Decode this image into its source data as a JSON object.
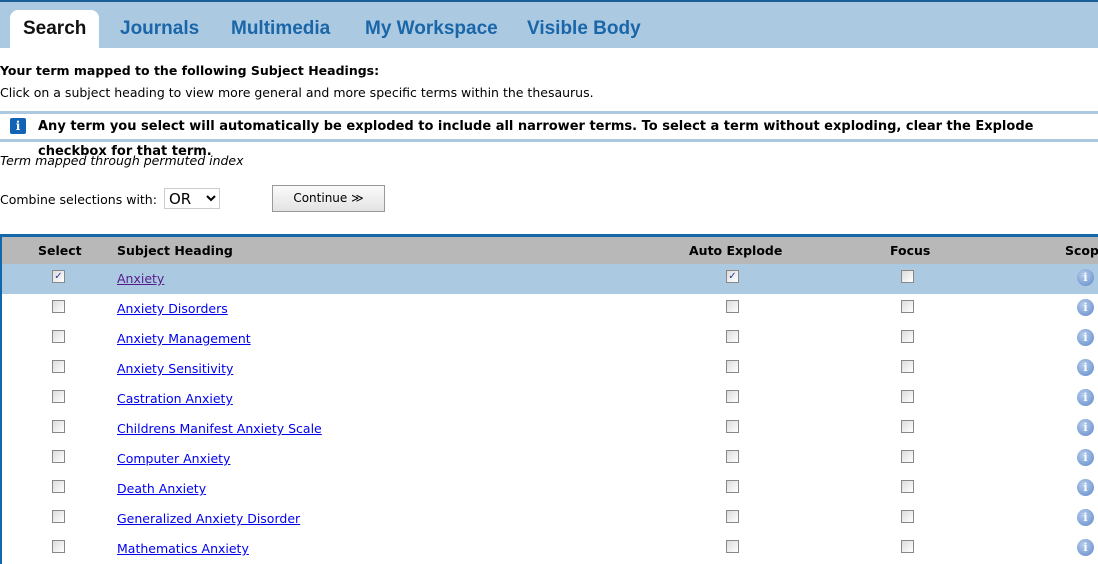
{
  "tabs": [
    {
      "label": "Search",
      "active": true
    },
    {
      "label": "Journals"
    },
    {
      "label": "Multimedia"
    },
    {
      "label": "My Workspace"
    },
    {
      "label": "Visible Body"
    }
  ],
  "intro": {
    "title": "Your term mapped to the following Subject Headings:",
    "subtitle": "Click on a subject heading to view more general and more specific terms within the thesaurus."
  },
  "notice": "Any term you select will automatically be exploded to include all narrower terms. To select a term without exploding, clear the Explode checkbox for that term.",
  "mapped_note": "Term mapped through permuted index",
  "combine": {
    "label": "Combine selections with:",
    "value": "OR"
  },
  "continue_label": "Continue ≫",
  "table": {
    "headers": {
      "select": "Select",
      "heading": "Subject Heading",
      "explode": "Auto Explode",
      "focus": "Focus",
      "scope": "Scope"
    },
    "rows": [
      {
        "heading": "Anxiety",
        "selected": true,
        "explode": true,
        "focus": false
      },
      {
        "heading": "Anxiety Disorders",
        "selected": false,
        "explode": false,
        "focus": false
      },
      {
        "heading": "Anxiety Management",
        "selected": false,
        "explode": false,
        "focus": false
      },
      {
        "heading": "Anxiety Sensitivity",
        "selected": false,
        "explode": false,
        "focus": false
      },
      {
        "heading": "Castration Anxiety",
        "selected": false,
        "explode": false,
        "focus": false
      },
      {
        "heading": "Childrens Manifest Anxiety Scale",
        "selected": false,
        "explode": false,
        "focus": false
      },
      {
        "heading": "Computer Anxiety",
        "selected": false,
        "explode": false,
        "focus": false
      },
      {
        "heading": "Death Anxiety",
        "selected": false,
        "explode": false,
        "focus": false
      },
      {
        "heading": "Generalized Anxiety Disorder",
        "selected": false,
        "explode": false,
        "focus": false
      },
      {
        "heading": "Mathematics Anxiety",
        "selected": false,
        "explode": false,
        "focus": false
      }
    ]
  },
  "colors": {
    "tabbar": "#abcae2",
    "link": "#0000ee",
    "visited": "#551a8b",
    "table_border": "#1467a8",
    "header_bg": "#b8b8b8"
  }
}
